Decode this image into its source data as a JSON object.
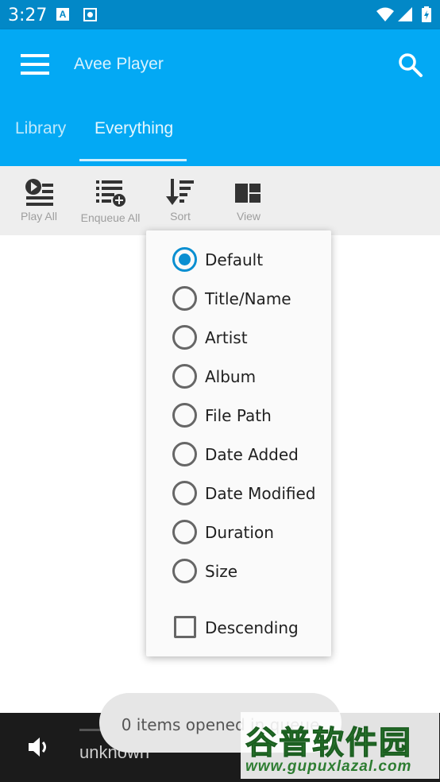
{
  "status_bar": {
    "time": "3:27",
    "a_icon_letter": "A"
  },
  "app_bar": {
    "title": "Avee Player",
    "menu_icon": "hamburger-menu-icon",
    "search_icon": "search-icon"
  },
  "tabs": [
    {
      "label": "Library",
      "selected": false
    },
    {
      "label": "Everything",
      "selected": true
    }
  ],
  "toolbar": {
    "play_all": "Play All",
    "enqueue_all": "Enqueue All",
    "sort": "Sort",
    "view": "View"
  },
  "sort_menu": {
    "options": [
      {
        "label": "Default",
        "selected": true
      },
      {
        "label": "Title/Name",
        "selected": false
      },
      {
        "label": "Artist",
        "selected": false
      },
      {
        "label": "Album",
        "selected": false
      },
      {
        "label": "File Path",
        "selected": false
      },
      {
        "label": "Date Added",
        "selected": false
      },
      {
        "label": "Date Modified",
        "selected": false
      },
      {
        "label": "Duration",
        "selected": false
      },
      {
        "label": "Size",
        "selected": false
      }
    ],
    "descending": {
      "label": "Descending",
      "checked": false
    }
  },
  "player": {
    "track": "unknown"
  },
  "toast": {
    "text": "0 items opened in queue"
  },
  "watermark": {
    "name": "谷普软件园",
    "url": "www.gupuxlazal.com"
  },
  "colors": {
    "status_bar": "#0288c7",
    "app_bar": "#03a9f4",
    "accent": "#0a8fd1",
    "toolbar_bg": "#eeeeee",
    "player_bg": "#1b1b1b"
  }
}
